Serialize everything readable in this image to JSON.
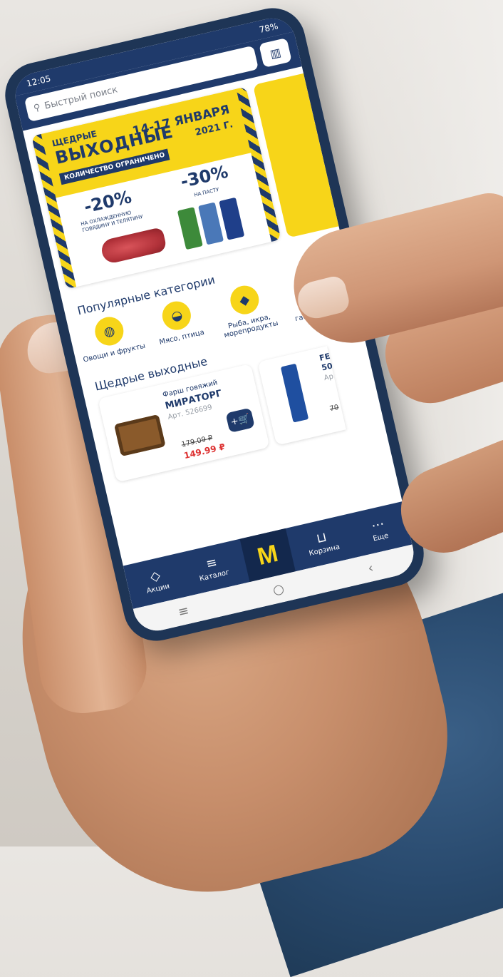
{
  "status_bar": {
    "time": "12:05",
    "battery": "78%"
  },
  "search": {
    "placeholder": "Быстрый поиск"
  },
  "banner": {
    "title_line1": "ЩЕДРЫЕ",
    "title_line2": "ВЫХОДНЫЕ",
    "limited": "КОЛИЧЕСТВО ОГРАНИЧЕНО",
    "dates": "14-17 ЯНВАРЯ",
    "year": "2021 Г.",
    "deal_a_percent": "-20%",
    "deal_a_desc": "НА ОХЛАЖДЕННУЮ ГОВЯДИНУ И ТЕЛЯТИНУ",
    "deal_b_percent": "-30%",
    "deal_b_desc": "НА ПАСТУ"
  },
  "popular_categories": {
    "title": "Популярные категории",
    "items": [
      {
        "label": "Овощи и фрукты",
        "icon": "apple-icon"
      },
      {
        "label": "Мясо, птица",
        "icon": "meat-icon"
      },
      {
        "label": "Рыба, икра, морепродукты",
        "icon": "fish-icon"
      },
      {
        "label": "Мясная гастрономия",
        "icon": "sausage-icon"
      }
    ]
  },
  "weekend_deals": {
    "title": "Щедрые выходные",
    "product_1": {
      "name": "Фарш говяжий",
      "brand": "МИРАТОРГ",
      "sku": "Арт. 526699",
      "old_price": "179.09 ₽",
      "new_price": "149.99 ₽",
      "add_label": "+🛒"
    },
    "product_2": {
      "title": "FE",
      "size": "50",
      "sku": "Ар",
      "old_price": "70"
    }
  },
  "bottom_nav": {
    "promo_label": "Акции",
    "catalog_label": "Каталог",
    "logo": "M",
    "cart_label": "Корзина",
    "more_label": "Еще"
  },
  "colors": {
    "brand_blue": "#1f3a6b",
    "brand_yellow": "#f7d519",
    "sale_red": "#dd3333"
  }
}
